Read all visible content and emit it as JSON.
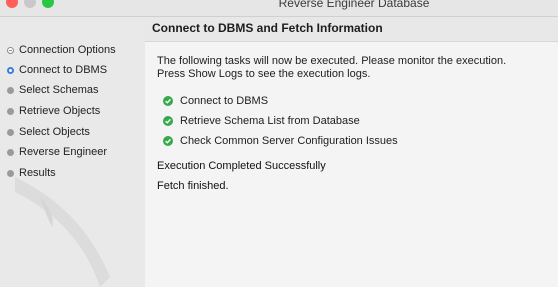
{
  "window": {
    "title": "Reverse Engineer Database"
  },
  "sidebar": {
    "steps": [
      {
        "label": "Connection Options",
        "state": "done"
      },
      {
        "label": "Connect to DBMS",
        "state": "current"
      },
      {
        "label": "Select Schemas",
        "state": "pending"
      },
      {
        "label": "Retrieve Objects",
        "state": "pending"
      },
      {
        "label": "Select Objects",
        "state": "pending"
      },
      {
        "label": "Reverse Engineer",
        "state": "pending"
      },
      {
        "label": "Results",
        "state": "pending"
      }
    ]
  },
  "main": {
    "header_title": "Connect to DBMS and Fetch Information",
    "description_line1": "The following tasks will now be executed. Please monitor the execution.",
    "description_line2": "Press Show Logs to see the execution logs.",
    "tasks": [
      {
        "label": "Connect to DBMS",
        "status": "completed"
      },
      {
        "label": "Retrieve Schema List from Database",
        "status": "completed"
      },
      {
        "label": "Check Common Server Configuration Issues",
        "status": "completed"
      }
    ],
    "status_text": "Execution Completed Successfully",
    "fetch_text": "Fetch finished."
  },
  "colors": {
    "success": "#37a94a",
    "current_step": "#3a7be0",
    "close": "#ff5f57",
    "maximize": "#29c840"
  }
}
